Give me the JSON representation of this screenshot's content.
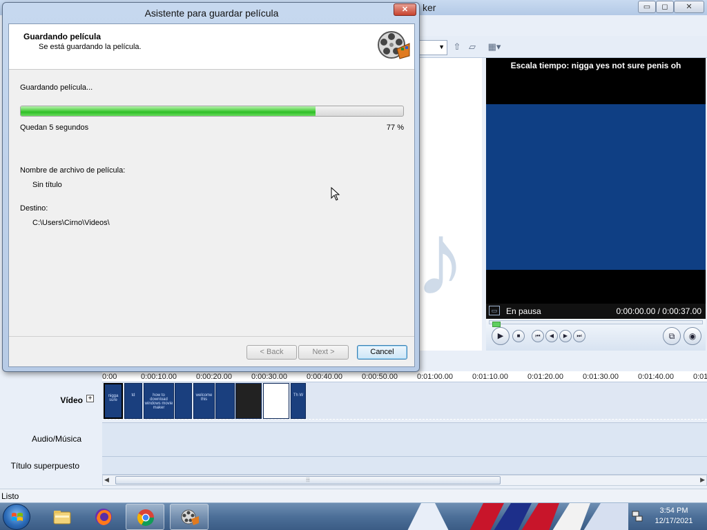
{
  "app": {
    "title_fragment": "ker",
    "min_glyph": "▭",
    "max_glyph": "◻",
    "close_glyph": "✕",
    "toolbar_icons": [
      "up-folder-icon",
      "new-folder-icon",
      "view-icon"
    ],
    "monitor": {
      "title": "Escala tiempo: nigga yes not sure penis oh",
      "status": "En pausa",
      "time": "0:00:00.00 / 0:00:37.00",
      "seek_fraction": 0.0
    },
    "timeline": {
      "ticks": [
        "0:00",
        "0:00:10.00",
        "0:00:20.00",
        "0:00:30.00",
        "0:00:40.00",
        "0:00:50.00",
        "0:01:00.00",
        "0:01:10.00",
        "0:01:20.00",
        "0:01:30.00",
        "0:01:40.00",
        "0:01"
      ],
      "video_label": "Vídeo",
      "expand_glyph": "+",
      "audio_label": "Audio/Música",
      "title_label": "Título superpuesto",
      "clips": [
        "nigga sure",
        "td",
        "how to download windows movie maker",
        "",
        "welcome this",
        "",
        "",
        "",
        "",
        "Th W"
      ]
    },
    "status": "Listo"
  },
  "dialog": {
    "title": "Asistente para guardar película",
    "close_glyph": "✕",
    "heading": "Guardando película",
    "subheading": "Se está guardando la película.",
    "saving_label": "Guardando película...",
    "progress_percent": 77,
    "remaining": "Quedan 5 segundos",
    "percent_text": "77 %",
    "filename_label": "Nombre de archivo de película:",
    "filename_value": "Sin título",
    "dest_label": "Destino:",
    "dest_value": "C:\\Users\\Cirno\\Videos\\",
    "back_label": "< Back",
    "next_label": "Next >",
    "cancel_label": "Cancel"
  },
  "taskbar": {
    "apps": [
      "explorer-icon",
      "firefox-icon",
      "chrome-icon",
      "movie-maker-icon"
    ],
    "clock_time": "3:54 PM",
    "clock_date": "12/17/2021"
  },
  "colors": {
    "progress": "#2fbe26",
    "monitor_screen": "#0f3f84",
    "clip": "#1a3f7e"
  }
}
